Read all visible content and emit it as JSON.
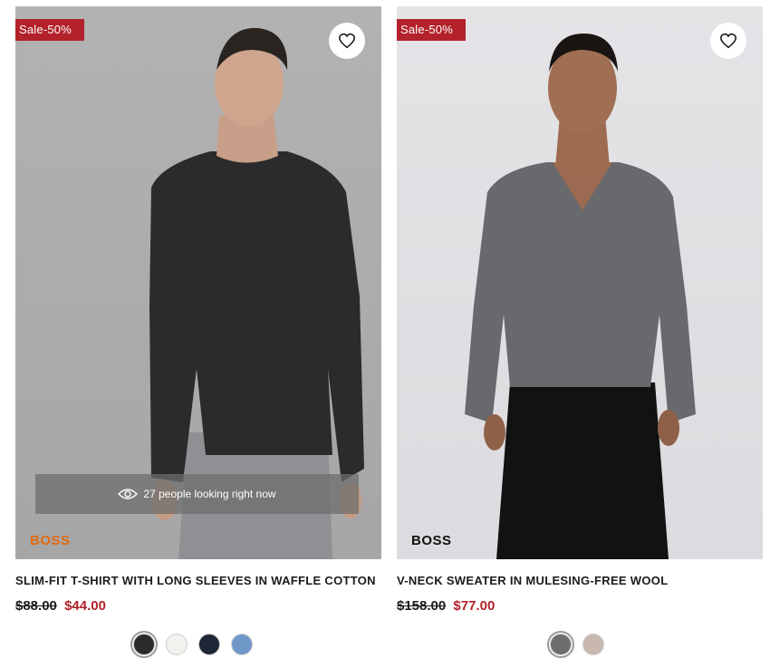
{
  "products": [
    {
      "badge": "Sale-50%",
      "brand": "BOSS",
      "brand_color": "#e26a10",
      "viewers_text": "27 people looking right now",
      "title": "SLIM-FIT T-SHIRT WITH LONG SLEEVES IN WAFFLE COTTON",
      "old_price": "$88.00",
      "new_price": "$44.00",
      "swatches": [
        "#2b2b2b",
        "#f3f1ee",
        "#1d2636",
        "#6f98c9"
      ]
    },
    {
      "badge": "Sale-50%",
      "brand": "BOSS",
      "brand_color": "#111111",
      "title": "V-NECK SWEATER IN MULESING-FREE WOOL",
      "old_price": "$158.00",
      "new_price": "$77.00",
      "swatches": [
        "#6e6e70",
        "#c9b8ad"
      ]
    }
  ],
  "icons": {
    "wishlist": "heart-outline-icon",
    "viewers": "eye-icon"
  },
  "colors": {
    "sale_red": "#b3222a",
    "text_dark": "#1b1b1b"
  }
}
